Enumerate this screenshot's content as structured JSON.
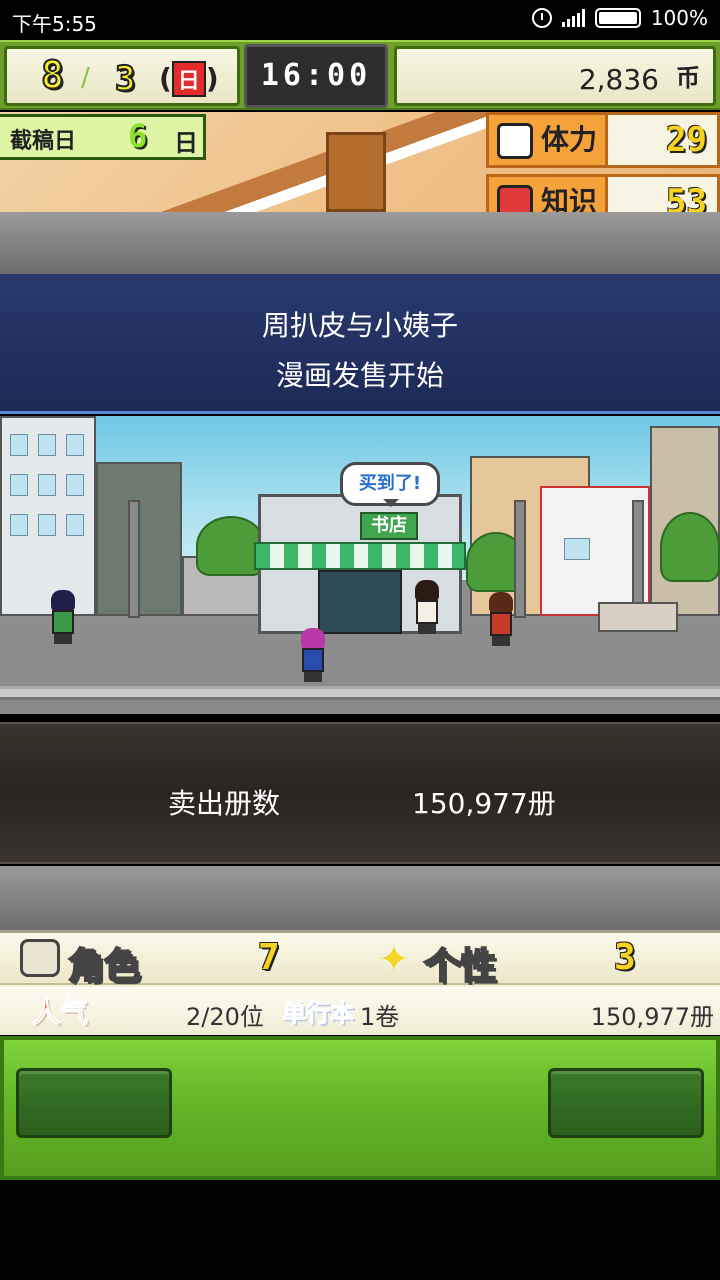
{
  "status_bar": {
    "time": "下午5:55",
    "battery": "100%"
  },
  "hud": {
    "month": "8",
    "day": "3",
    "weekday": "日",
    "clock": "16:00",
    "money": "2,836",
    "money_unit": "币"
  },
  "deadline": {
    "label": "截稿日",
    "days": "6",
    "unit": "日"
  },
  "stats_top": [
    {
      "label": "体力",
      "value": "29",
      "icon": "muscle-icon"
    },
    {
      "label": "知识",
      "value": "53",
      "icon": "book-icon"
    }
  ],
  "event": {
    "line1": "周扒皮与小姨子",
    "line2": "漫画发售开始"
  },
  "scene": {
    "speech": "买到了!",
    "shop_sign": "书店"
  },
  "sales": {
    "label": "卖出册数",
    "value": "150,977册"
  },
  "manga_stats": {
    "character_label": "角色",
    "character_value": "7",
    "personality_label": "个性",
    "personality_value": "3",
    "popularity_label": "人气",
    "rank": "2/20位",
    "volume_label": "单行本",
    "volumes": "1卷",
    "total_sold": "150,977册"
  },
  "colors": {
    "hud_green": "#6d9f2a",
    "event_blue": "#223060",
    "panel_green": "#67b82a"
  }
}
